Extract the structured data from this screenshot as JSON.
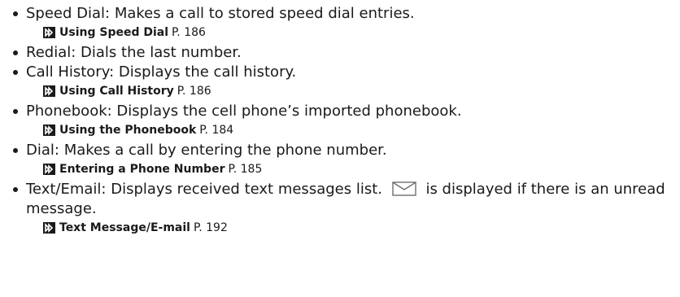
{
  "items": [
    {
      "term": "Speed Dial",
      "desc": ": Makes a call to stored speed dial entries.",
      "ref_title": "Using Speed Dial",
      "ref_page": "P. 186"
    },
    {
      "term": "Redial",
      "desc": ": Dials the last number."
    },
    {
      "term": "Call History",
      "desc": ": Displays the call history.",
      "ref_title": "Using Call History",
      "ref_page": "P. 186"
    },
    {
      "term": "Phonebook",
      "desc": ": Displays the cell phone’s imported phonebook.",
      "ref_title": "Using the Phonebook",
      "ref_page": "P. 184"
    },
    {
      "term": "Dial",
      "desc": ": Makes a call by entering the phone number.",
      "ref_title": "Entering a Phone Number",
      "ref_page": "P. 185"
    },
    {
      "term": "Text/Email",
      "desc_before_icon": ": Displays received text messages list.",
      "desc_after_icon": "is displayed if there is an unread message.",
      "icon": "envelope-icon",
      "ref_title": "Text Message/E-mail",
      "ref_page": "P. 192"
    }
  ]
}
